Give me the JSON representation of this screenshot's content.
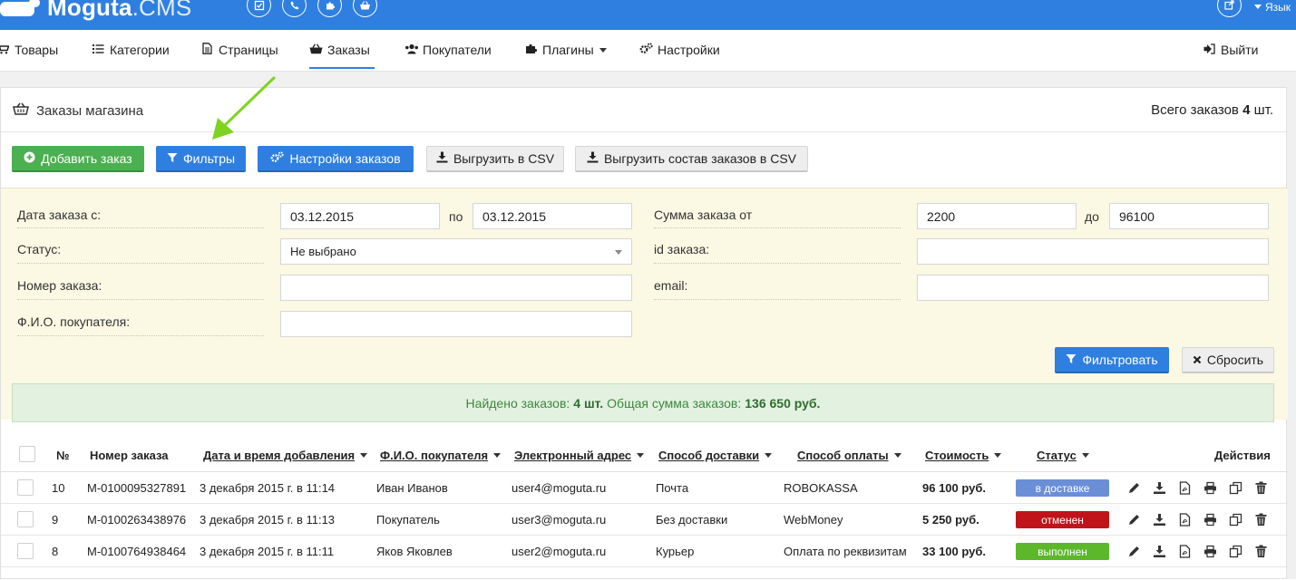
{
  "app": {
    "logo_main": "Moguta",
    "logo_suffix": ".CMS"
  },
  "topbar": {
    "lang_label": "Язык"
  },
  "nav": {
    "items": [
      {
        "label": "Товары",
        "icon": "cart-icon"
      },
      {
        "label": "Категории",
        "icon": "list-icon"
      },
      {
        "label": "Страницы",
        "icon": "file-icon"
      },
      {
        "label": "Заказы",
        "icon": "basket-icon"
      },
      {
        "label": "Покупатели",
        "icon": "users-icon"
      },
      {
        "label": "Плагины",
        "icon": "puzzle-icon"
      },
      {
        "label": "Настройки",
        "icon": "gears-icon"
      }
    ],
    "logout": "Выйти"
  },
  "panel": {
    "title": "Заказы магазина",
    "total_prefix": "Всего заказов",
    "total_count": "4",
    "total_suffix": "шт."
  },
  "toolbar": {
    "add": "Добавить заказ",
    "filters": "Фильтры",
    "settings": "Настройки заказов",
    "export_csv": "Выгрузить в CSV",
    "export_items_csv": "Выгрузить состав заказов в CSV"
  },
  "filter": {
    "date_label": "Дата заказа с:",
    "date_from": "03.12.2015",
    "date_sep": "по",
    "date_to": "03.12.2015",
    "sum_label": "Сумма заказа от",
    "sum_from": "2200",
    "sum_sep": "до",
    "sum_to": "96100",
    "status_label": "Статус:",
    "status_value": "Не выбрано",
    "id_label": "id заказа:",
    "id_value": "",
    "number_label": "Номер заказа:",
    "number_value": "",
    "email_label": "email:",
    "email_value": "",
    "fio_label": "Ф.И.О. покупателя:",
    "fio_value": "",
    "apply": "Фильтровать",
    "reset": "Сбросить"
  },
  "found": {
    "prefix": "Найдено заказов:",
    "count": "4 шт.",
    "middle": "Общая сумма заказов:",
    "sum": "136 650 руб."
  },
  "table": {
    "headers": {
      "num": "№",
      "order_number": "Номер заказа",
      "date": "Дата и время добавления",
      "fio": "Ф.И.О. покупателя",
      "email": "Электронный адрес",
      "delivery": "Способ доставки",
      "payment": "Способ оплаты",
      "cost": "Стоимость",
      "status": "Статус",
      "actions": "Действия"
    },
    "rows": [
      {
        "num": "10",
        "order_number": "M-0100095327891",
        "date": "3 декабря 2015 г. в 11:14",
        "fio": "Иван Иванов",
        "email": "user4@moguta.ru",
        "delivery": "Почта",
        "payment": "ROBOKASSA",
        "cost": "96 100 руб.",
        "status": "в доставке",
        "status_color": "#6b8fd6"
      },
      {
        "num": "9",
        "order_number": "M-0100263438976",
        "date": "3 декабря 2015 г. в 11:13",
        "fio": "Покупатель",
        "email": "user3@moguta.ru",
        "delivery": "Без доставки",
        "payment": "WebMoney",
        "cost": "5 250 руб.",
        "status": "отменен",
        "status_color": "#c0141a"
      },
      {
        "num": "8",
        "order_number": "M-0100764938464",
        "date": "3 декабря 2015 г. в 11:11",
        "fio": "Яков Яковлев",
        "email": "user2@moguta.ru",
        "delivery": "Курьер",
        "payment": "Оплата по реквизитам",
        "cost": "33 100 руб.",
        "status": "выполнен",
        "status_color": "#5cb82a"
      }
    ]
  },
  "colors": {
    "brand_blue": "#2f7fe0",
    "green_button": "#4caf50",
    "filter_bg": "#fbf8e3",
    "found_bg": "#e3f1e1",
    "arrow": "#7ed321"
  }
}
